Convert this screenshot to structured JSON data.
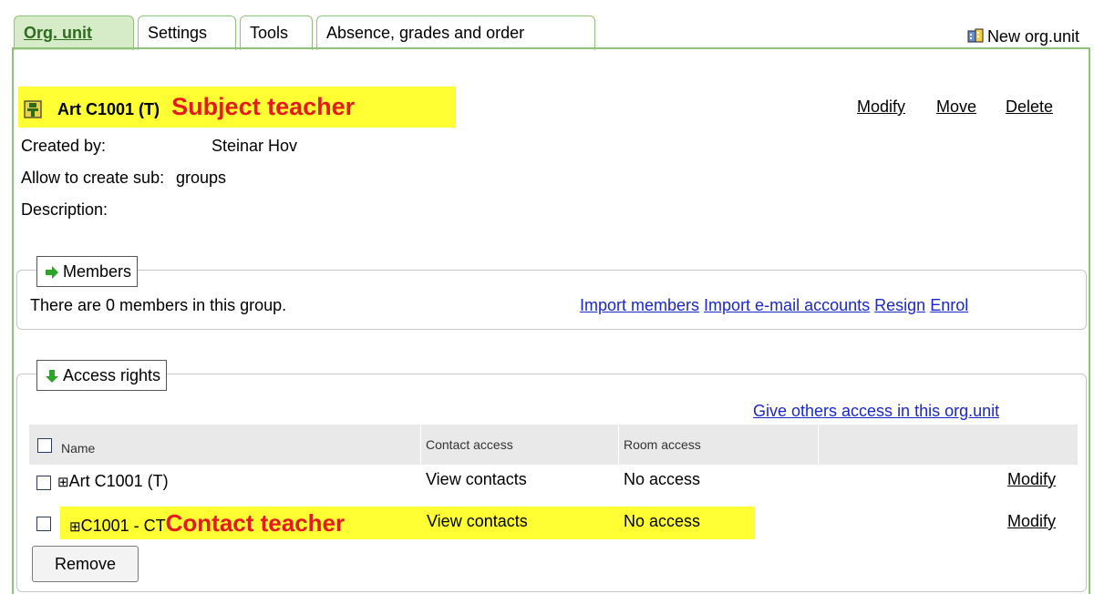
{
  "tabs": [
    {
      "label": "Org. unit"
    },
    {
      "label": "Settings"
    },
    {
      "label": "Tools"
    },
    {
      "label": "Absence, grades and order"
    }
  ],
  "new_org_unit_label": "New org.unit",
  "header": {
    "title": "Art C1001 (T)",
    "annotation": "Subject teacher",
    "actions": {
      "modify": "Modify",
      "move": "Move",
      "delete": "Delete"
    }
  },
  "info": {
    "created_by_label": "Created by:",
    "created_by_value": "Steinar Hov",
    "allow_label": "Allow to create sub:",
    "allow_value": "groups",
    "description_label": "Description:"
  },
  "members": {
    "legend": "Members",
    "status": "There are 0 members in this group.",
    "links": {
      "import_members": "Import members",
      "import_email": "Import e-mail accounts",
      "resign": "Resign",
      "enrol": "Enrol"
    }
  },
  "access": {
    "legend": "Access rights",
    "give_access_link": "Give others access in this org.unit",
    "columns": {
      "name": "Name",
      "contact": "Contact access",
      "room": "Room access"
    },
    "rows": [
      {
        "name": "Art C1001 (T)",
        "contact": "View contacts",
        "room": "No access",
        "action": "Modify"
      },
      {
        "name": "C1001 - CT",
        "annotation": "Contact teacher",
        "contact": "View contacts",
        "room": "No access",
        "action": "Modify"
      }
    ],
    "remove_button": "Remove"
  },
  "colors": {
    "accent_green": "#8fc27a",
    "highlight": "#ffff33",
    "annotation_red": "#e51b1b",
    "link_blue": "#1a29c9"
  }
}
